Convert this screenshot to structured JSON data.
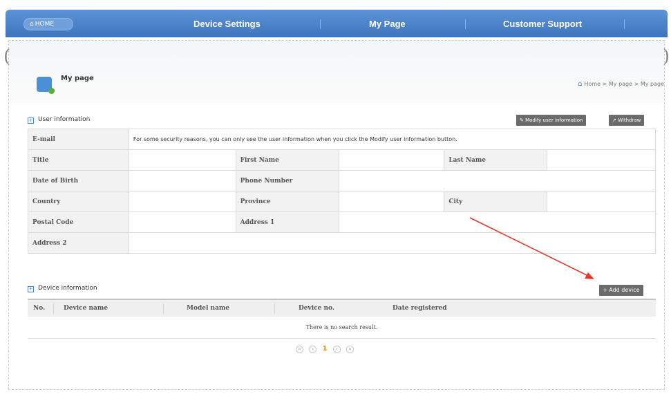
{
  "nav": {
    "home": "HOME",
    "items": [
      "Device Settings",
      "My Page",
      "Customer Support"
    ]
  },
  "page": {
    "title": "My page",
    "breadcrumb": "Home > My page > My page"
  },
  "user_info": {
    "title": "User information",
    "modify_button": "Modify user information",
    "withdraw_button": "Withdraw",
    "email_label": "E-mail",
    "email_notice": "For some security reasons, you can only see the user information when you click the Modify user information button.",
    "labels": {
      "title": "Title",
      "first_name": "First Name",
      "last_name": "Last Name",
      "dob": "Date of Birth",
      "phone": "Phone Number",
      "country": "Country",
      "province": "Province",
      "city": "City",
      "postal": "Postal Code",
      "address1": "Address 1",
      "address2": "Address 2"
    }
  },
  "device_info": {
    "title": "Device information",
    "add_button": "Add device",
    "columns": [
      "No.",
      "Device name",
      "Model name",
      "Device no.",
      "Date registered"
    ],
    "empty": "There is no search result.",
    "pager": {
      "first": "«",
      "prev": "‹",
      "current": "1",
      "next": "›",
      "last": "»"
    }
  },
  "colors": {
    "nav": "#4a82c8",
    "annotation_arrow": "#e03a2a"
  },
  "icons": [
    "home-icon",
    "user-add-icon",
    "edit-icon",
    "withdraw-icon",
    "plus-icon"
  ]
}
